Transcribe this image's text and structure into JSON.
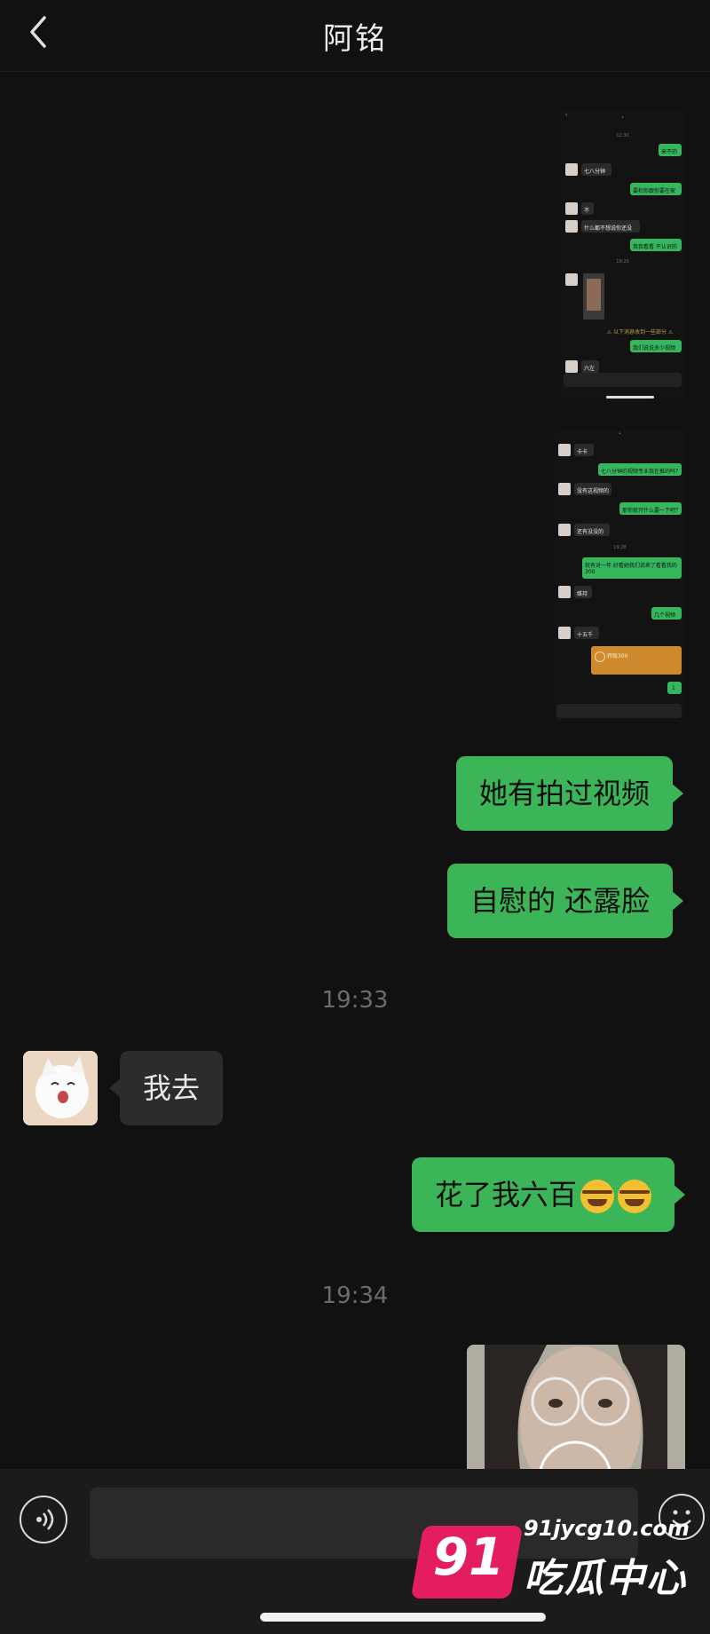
{
  "header": {
    "title": "阿铭"
  },
  "screenshot1": {
    "timestamps": [
      "12:30",
      "19:20"
    ],
    "messages_me": [
      "来不的",
      "要和你跟你要在家",
      "我我看看 不认识的",
      "我们说说多少视频"
    ],
    "messages_other": [
      "七八分钟",
      "不",
      "什么都不想说你还没",
      "六左"
    ],
    "warning": "⚠ 以下消息收到一些部分 ⚠"
  },
  "screenshot2": {
    "timestamp": "19:28",
    "messages_me": [
      "七八分钟的视频专业我在推的吗？",
      "那你就开什么要一下吧？",
      "就有对一年 好看她我们说来了看看我的 300",
      "几个视频",
      "1"
    ],
    "messages_other": [
      "卡卡",
      "没有这视频的",
      "还有没没的",
      "维持",
      "十五千"
    ],
    "transfer": "转账300"
  },
  "chat": {
    "messages": [
      {
        "side": "me",
        "text": "她有拍过视频"
      },
      {
        "side": "me",
        "text": "自慰的 还露脸"
      },
      {
        "side": "time",
        "text": "19:33"
      },
      {
        "side": "other",
        "text": "我去"
      },
      {
        "side": "me",
        "text": "花了我六百"
      },
      {
        "side": "time",
        "text": "19:34"
      }
    ]
  },
  "watermark": {
    "number": "91",
    "url": "91jycg10.com",
    "brand": "吃瓜中心"
  },
  "colors": {
    "accent_green": "#3cb559",
    "background": "#111111",
    "watermark": "#e41d5f"
  },
  "icons": [
    "back-icon",
    "voice-icon",
    "emoji-icon"
  ]
}
